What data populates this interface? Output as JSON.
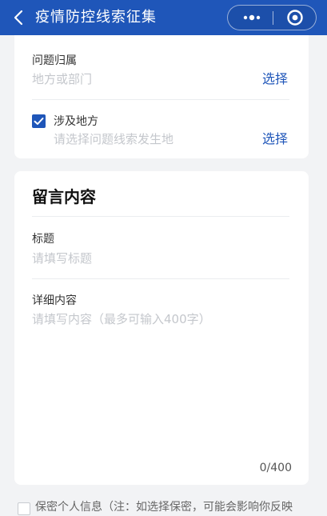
{
  "header": {
    "title": "疫情防控线索征集"
  },
  "location_card": {
    "ownership_label": "问题归属",
    "ownership_placeholder": "地方或部门",
    "ownership_select": "选择",
    "involved_label": "涉及地方",
    "involved_checked": true,
    "involved_placeholder": "请选择问题线索发生地",
    "involved_select": "选择"
  },
  "message_card": {
    "title": "留言内容",
    "subject_label": "标题",
    "subject_placeholder": "请填写标题",
    "detail_label": "详细内容",
    "detail_placeholder": "请填写内容（最多可输入400字）",
    "counter": "0/400"
  },
  "bottom": {
    "privacy_text": "保密个人信息（注：如选择保密，可能会影响你反映"
  },
  "colors": {
    "accent": "#1f56b9",
    "placeholder": "#c4c7cc",
    "background": "#f2f3f5"
  }
}
